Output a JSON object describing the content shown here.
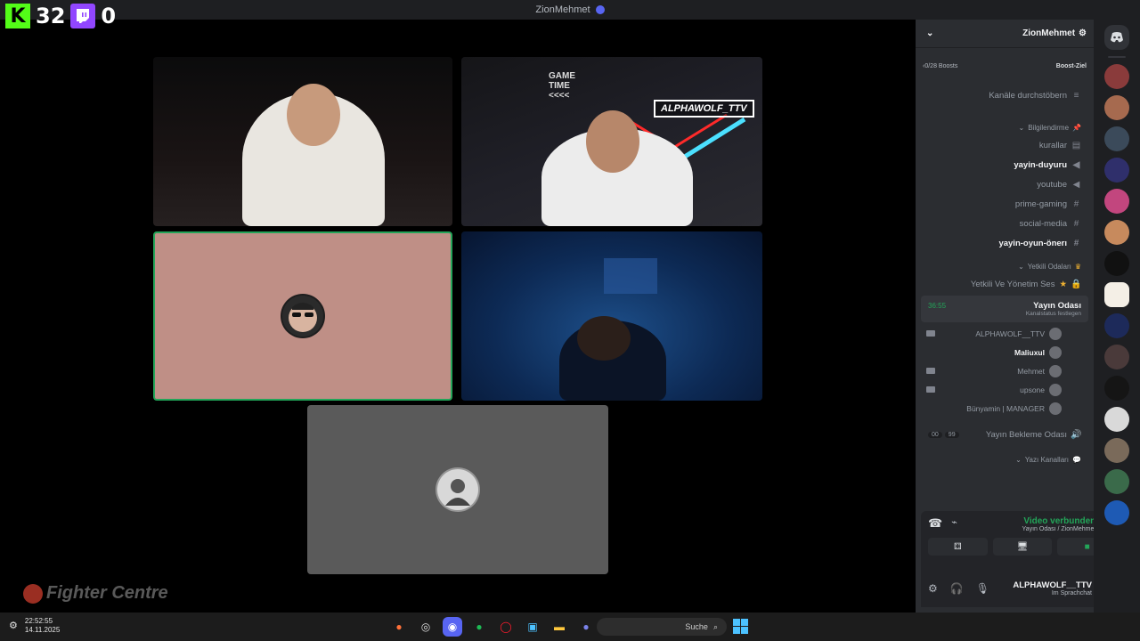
{
  "window": {
    "title": "ZionMehmet"
  },
  "overlay": {
    "kick_count": "32",
    "twitch_count": "0",
    "kick_letter": "K"
  },
  "tiles": {
    "cam2_label": "ALPHAWOLF_TTV",
    "cam2_sign": "GAME\nTIME\n<<<<"
  },
  "watermark": {
    "text": "Fighter Centre"
  },
  "server": {
    "name": "ZionMehmet",
    "boost_label": "Boost-Ziel",
    "boost_count": "0/28 Boosts",
    "browse": "Kanäle durchstöbern"
  },
  "channels": {
    "cat1": "Bilgilendirme",
    "kurallar": "kurallar",
    "yayin_duyuru": "yayin-duyuru",
    "youtube": "youtube",
    "prime_gaming": "prime-gaming",
    "social_media": "social-media",
    "yayin_oyun_oneri": "yayin-oyun-önerı",
    "cat2": "Yetkili Odaları",
    "yetkili": "Yetkili Ve Yönetim Ses",
    "vc_name": "Yayın Odası",
    "vc_timer": "36:55",
    "vc_sub": "Kanalstatus festlegen",
    "waiting": "Yayın Bekleme Odası",
    "waiting_count_a": "00",
    "waiting_count_b": "99",
    "cat3": "Yazı Kanalları"
  },
  "members": [
    {
      "name": "ALPHAWOLF__TTV",
      "bold": false,
      "cam": true
    },
    {
      "name": "Maliuxul",
      "bold": true,
      "cam": false
    },
    {
      "name": "Mehmet",
      "bold": false,
      "cam": true
    },
    {
      "name": "upsone",
      "bold": false,
      "cam": true
    },
    {
      "name": "Bünyamin | MANAGER",
      "bold": false,
      "cam": false
    }
  ],
  "voice_panel": {
    "status": "Video verbunden",
    "channel": "Yayın Odası / ZionMehmet"
  },
  "user_panel": {
    "name": "ALPHAWOLF__TTV",
    "status": "Im Sprachchat"
  },
  "taskbar": {
    "time": "22:52:55",
    "date": "14.11.2025",
    "search_placeholder": "Suche"
  },
  "colors": {
    "discord_green": "#23a559",
    "blurple": "#5865f2",
    "kick_green": "#53fc18",
    "twitch_purple": "#9146ff"
  }
}
